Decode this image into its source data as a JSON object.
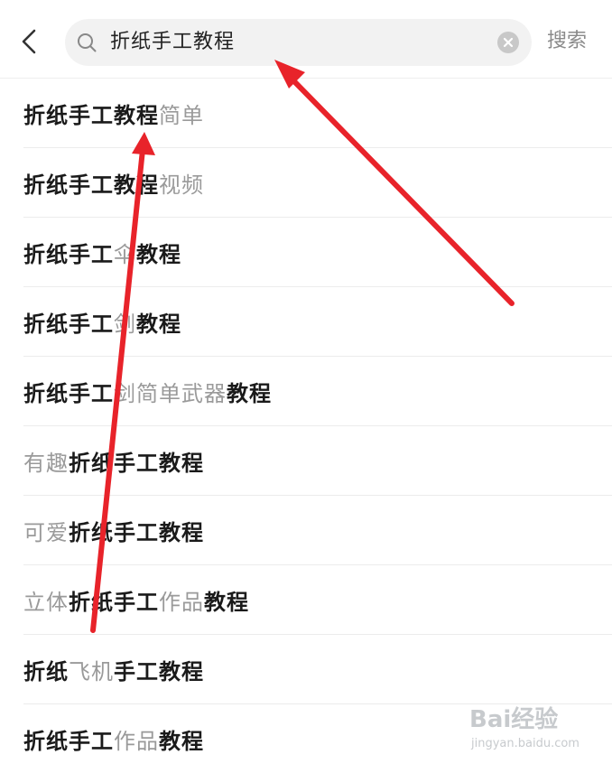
{
  "header": {
    "back_icon": "chevron-left-icon",
    "search_value": "折纸手工教程",
    "search_icon": "search-icon",
    "clear_icon": "clear-circle-icon",
    "search_button_label": "搜索"
  },
  "suggestions": [
    {
      "segments": [
        {
          "text": "折纸手工教程",
          "bold": true
        },
        {
          "text": "简单",
          "bold": false
        }
      ]
    },
    {
      "segments": [
        {
          "text": "折纸手工教程",
          "bold": true
        },
        {
          "text": "视频",
          "bold": false
        }
      ]
    },
    {
      "segments": [
        {
          "text": "折纸手工",
          "bold": true
        },
        {
          "text": "伞",
          "bold": false
        },
        {
          "text": "教程",
          "bold": true
        }
      ]
    },
    {
      "segments": [
        {
          "text": "折纸手工",
          "bold": true
        },
        {
          "text": "剑",
          "bold": false
        },
        {
          "text": "教程",
          "bold": true
        }
      ]
    },
    {
      "segments": [
        {
          "text": "折纸手工",
          "bold": true
        },
        {
          "text": "剑简单武器",
          "bold": false
        },
        {
          "text": "教程",
          "bold": true
        }
      ]
    },
    {
      "segments": [
        {
          "text": "有趣",
          "bold": false
        },
        {
          "text": "折纸手工教程",
          "bold": true
        }
      ]
    },
    {
      "segments": [
        {
          "text": "可爱",
          "bold": false
        },
        {
          "text": "折纸手工教程",
          "bold": true
        }
      ]
    },
    {
      "segments": [
        {
          "text": "立体",
          "bold": false
        },
        {
          "text": "折纸手工",
          "bold": true
        },
        {
          "text": "作品",
          "bold": false
        },
        {
          "text": "教程",
          "bold": true
        }
      ]
    },
    {
      "segments": [
        {
          "text": "折纸",
          "bold": true
        },
        {
          "text": "飞机",
          "bold": false
        },
        {
          "text": "手工教程",
          "bold": true
        }
      ]
    },
    {
      "segments": [
        {
          "text": "折纸手工",
          "bold": true
        },
        {
          "text": "作品",
          "bold": false
        },
        {
          "text": "教程",
          "bold": true
        }
      ]
    }
  ],
  "annotations": {
    "arrow_color": "#e8232a"
  },
  "watermark": {
    "logo_text": "Bai经验",
    "url_text": "jingyan.baidu.com"
  }
}
